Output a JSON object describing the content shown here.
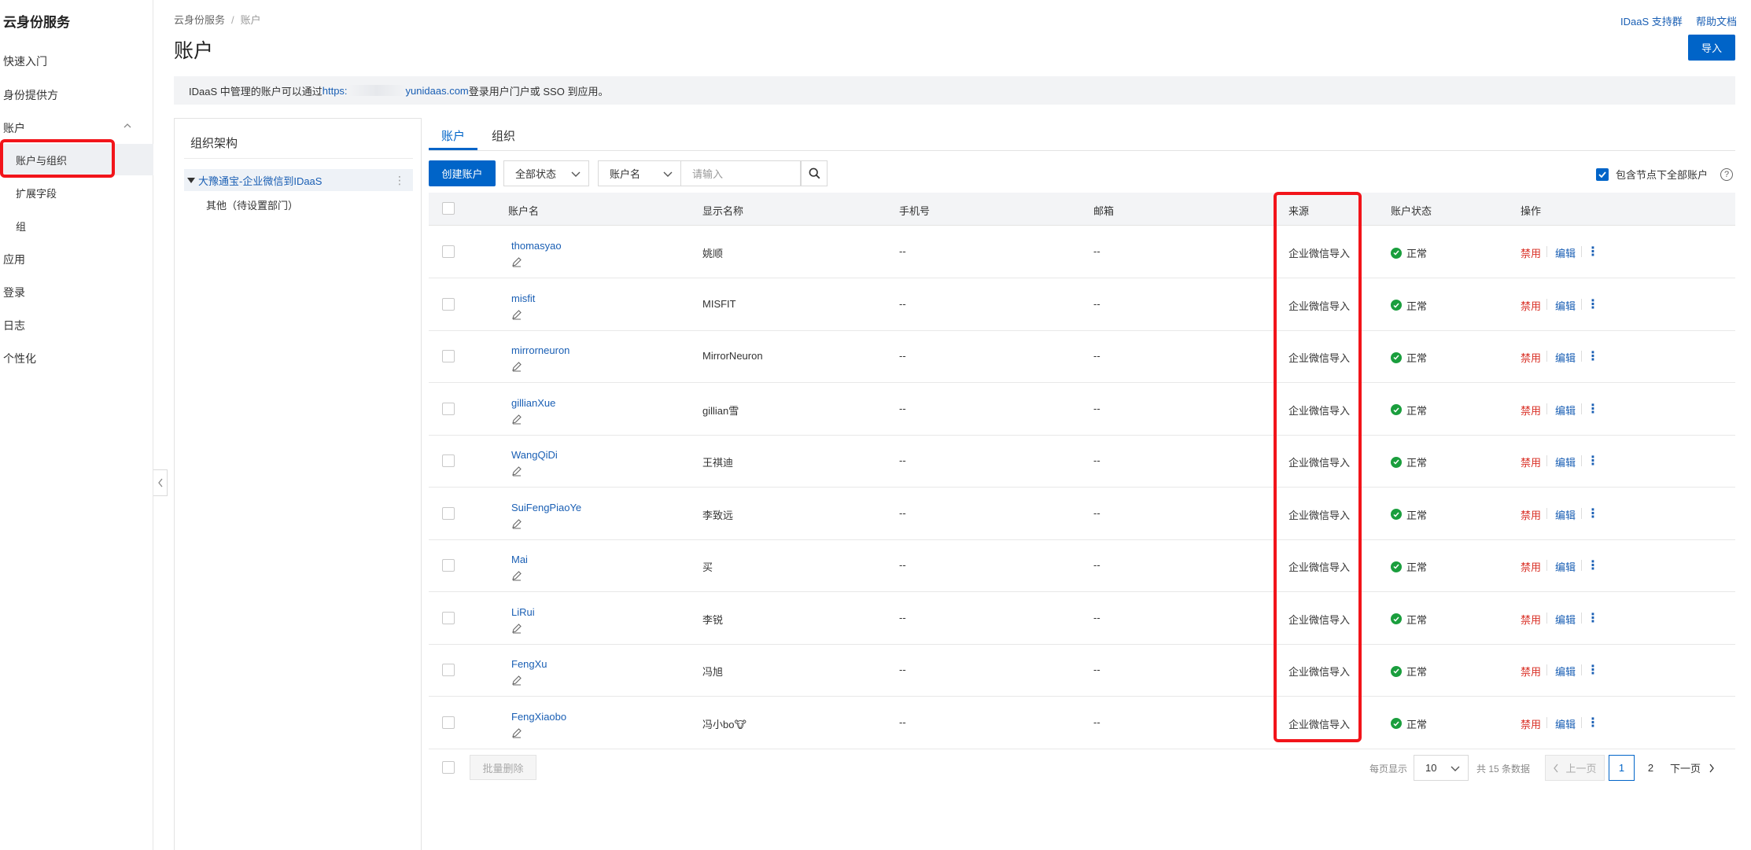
{
  "app": {
    "title": "云身份服务"
  },
  "sidebar": {
    "items": [
      {
        "label": "快速入门"
      },
      {
        "label": "身份提供方"
      },
      {
        "label": "账户"
      },
      {
        "label": "应用"
      },
      {
        "label": "登录"
      },
      {
        "label": "日志"
      },
      {
        "label": "个性化"
      }
    ],
    "sub_items": [
      {
        "label": "账户与组织"
      },
      {
        "label": "扩展字段"
      },
      {
        "label": "组"
      }
    ]
  },
  "header": {
    "breadcrumb": [
      "云身份服务",
      "账户"
    ],
    "title": "账户",
    "links": [
      "IDaaS 支持群",
      "帮助文档"
    ],
    "import_label": "导入"
  },
  "notice": {
    "prefix": "IDaaS 中管理的账户可以通过 ",
    "link_start": "https:",
    "link_end": "yunidaas.com",
    "suffix": " 登录用户门户或 SSO 到应用。"
  },
  "org": {
    "title": "组织架构",
    "root": "大豫通宝-企业微信到IDaaS",
    "child": "其他（待设置部门）"
  },
  "tabs": [
    {
      "label": "账户"
    },
    {
      "label": "组织"
    }
  ],
  "toolbar": {
    "create_label": "创建账户",
    "status_filter": "全部状态",
    "field_select": "账户名",
    "search_placeholder": "请输入",
    "include_label": "包含节点下全部账户",
    "help": "?"
  },
  "table": {
    "columns": [
      "账户名",
      "显示名称",
      "手机号",
      "邮箱",
      "来源",
      "账户状态",
      "操作"
    ],
    "ops": {
      "disable": "禁用",
      "edit": "编辑",
      "more": "⋮"
    },
    "rows": [
      {
        "username": "thomasyao",
        "display": "姚顺",
        "phone": "--",
        "email": "--",
        "source": "企业微信导入",
        "status": "正常"
      },
      {
        "username": "misfit",
        "display": "MISFIT",
        "phone": "--",
        "email": "--",
        "source": "企业微信导入",
        "status": "正常"
      },
      {
        "username": "mirrorneuron",
        "display": "MirrorNeuron",
        "phone": "--",
        "email": "--",
        "source": "企业微信导入",
        "status": "正常"
      },
      {
        "username": "gillianXue",
        "display": "gillian雪",
        "phone": "--",
        "email": "--",
        "source": "企业微信导入",
        "status": "正常"
      },
      {
        "username": "WangQiDi",
        "display": "王祺迪",
        "phone": "--",
        "email": "--",
        "source": "企业微信导入",
        "status": "正常"
      },
      {
        "username": "SuiFengPiaoYe",
        "display": "李致远",
        "phone": "--",
        "email": "--",
        "source": "企业微信导入",
        "status": "正常"
      },
      {
        "username": "Mai",
        "display": "买",
        "phone": "--",
        "email": "--",
        "source": "企业微信导入",
        "status": "正常"
      },
      {
        "username": "LiRui",
        "display": "李锐",
        "phone": "--",
        "email": "--",
        "source": "企业微信导入",
        "status": "正常"
      },
      {
        "username": "FengXu",
        "display": "冯旭",
        "phone": "--",
        "email": "--",
        "source": "企业微信导入",
        "status": "正常"
      },
      {
        "username": "FengXiaobo",
        "display": "冯小bo🐮",
        "phone": "--",
        "email": "--",
        "source": "企业微信导入",
        "status": "正常"
      }
    ]
  },
  "footer": {
    "batch_delete": "批量删除",
    "per_page_label": "每页显示",
    "per_page_value": "10",
    "total": "共 15 条数据",
    "prev": "上一页",
    "pages": [
      "1",
      "2"
    ],
    "next": "下一页"
  },
  "colors": {
    "primary": "#0064c8",
    "link": "#1a5fb4",
    "danger": "#d93026",
    "success": "#1a9e3d",
    "highlight": "#f2141a"
  }
}
